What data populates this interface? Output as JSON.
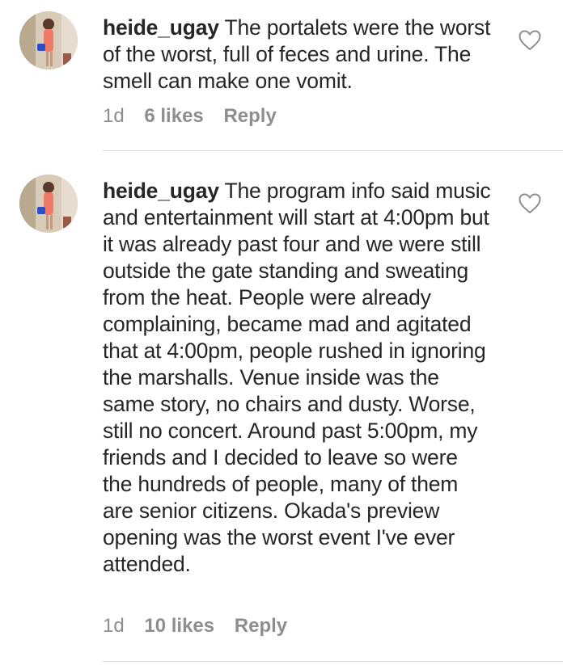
{
  "comments": [
    {
      "username": "heide_ugay",
      "text": "The portalets were the worst of the worst, full of feces and urine. The smell can make one vomit.",
      "time": "1d",
      "likes": "6 likes",
      "reply_label": "Reply",
      "avatar_icon": "user-avatar-photo",
      "like_icon": "heart-outline-icon"
    },
    {
      "username": "heide_ugay",
      "text": "The program info said music and entertainment will start at 4:00pm but it was already past four and we were still outside the gate standing and sweating from the heat. People were already complaining, became mad and agitated that at 4:00pm, people rushed in ignoring the marshalls. Venue inside was the same story, no chairs and dusty. Worse, still no concert. Around past 5:00pm, my friends and I decided to leave so were the hundreds of people, many of them are senior citizens. Okada's preview opening was the worst event I've ever attended.",
      "time": "1d",
      "likes": "10 likes",
      "reply_label": "Reply",
      "avatar_icon": "user-avatar-photo",
      "like_icon": "heart-outline-icon"
    }
  ],
  "colors": {
    "text": "#262626",
    "meta": "#8e8e8e",
    "divider": "#dbdbdb"
  }
}
